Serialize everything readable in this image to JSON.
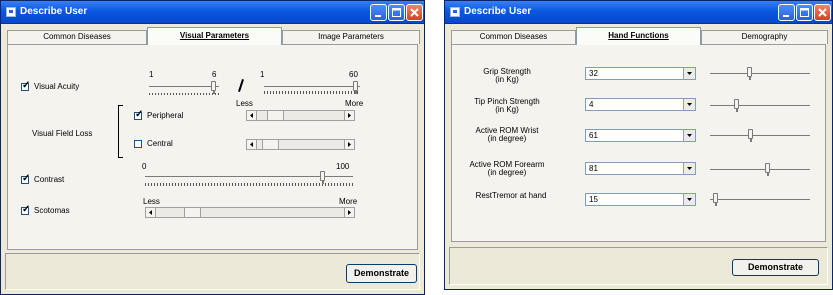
{
  "left_window": {
    "title": "Describe User",
    "tabs": [
      {
        "label": "Common Diseases"
      },
      {
        "label": "Visual Parameters"
      },
      {
        "label": "Image Parameters"
      }
    ],
    "visual_acuity": {
      "label": "Visual Acuity",
      "checked": true,
      "scale_left": {
        "min": "1",
        "max": "6"
      },
      "scale_right": {
        "min": "1",
        "max": "60"
      }
    },
    "visual_field_loss": {
      "label": "Visual Field Loss",
      "less_label": "Less",
      "more_label": "More",
      "peripheral": {
        "label": "Peripheral",
        "checked": true
      },
      "central": {
        "label": "Central",
        "checked": false
      }
    },
    "contrast": {
      "label": "Contrast",
      "checked": true,
      "min": "0",
      "max": "100"
    },
    "scotomas": {
      "label": "Scotomas",
      "checked": true,
      "less_label": "Less",
      "more_label": "More"
    },
    "demonstrate_label": "Demonstrate"
  },
  "right_window": {
    "title": "Describe User",
    "tabs": [
      {
        "label": "Common Diseases"
      },
      {
        "label": "Hand Functions"
      },
      {
        "label": "Demography"
      }
    ],
    "rows": [
      {
        "label": "Grip Strength",
        "unit": "(in Kg)",
        "value": "32"
      },
      {
        "label": "Tip Pinch Strength",
        "unit": "(in Kg)",
        "value": "4"
      },
      {
        "label": "Active ROM Wrist",
        "unit": "(in degree)",
        "value": "61"
      },
      {
        "label": "Active ROM Forearm",
        "unit": "(in degree)",
        "value": "81"
      },
      {
        "label": "RestTremor at hand",
        "unit": "",
        "value": "15"
      }
    ],
    "demonstrate_label": "Demonstrate"
  }
}
